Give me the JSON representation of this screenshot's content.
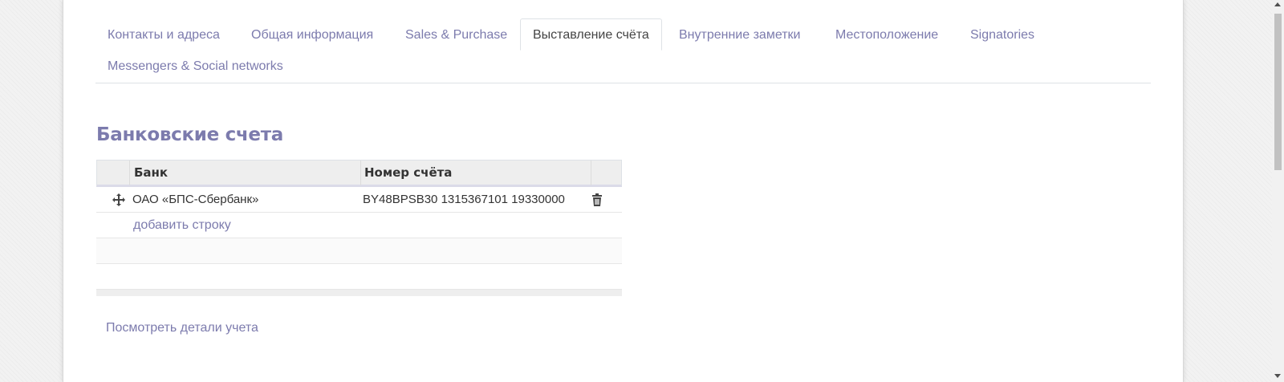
{
  "tabs": [
    {
      "label": "Контакты и адреса"
    },
    {
      "label": "Общая информация"
    },
    {
      "label": "Sales & Purchase"
    },
    {
      "label": "Выставление счёта",
      "active": true
    },
    {
      "label": "Внутренние заметки"
    },
    {
      "label": "Местоположение"
    },
    {
      "label": "Signatories"
    },
    {
      "label": "Messengers & Social networks"
    }
  ],
  "bank_section": {
    "title": "Банковские счета",
    "columns": {
      "bank": "Банк",
      "account_number": "Номер счёта"
    },
    "rows": [
      {
        "bank": "ОАО «БПС-Сбербанк»",
        "account_number": "BY48BPSB30 1315367101 19330000"
      }
    ],
    "add_row_label": "добавить строку",
    "view_details_label": "Посмотреть детали учета"
  },
  "colors": {
    "accent": "#7c7bad",
    "text": "#333333",
    "header_bg": "#eeeeee"
  },
  "icons": {
    "drag_handle": "move-arrows-icon",
    "delete": "trash-icon"
  }
}
